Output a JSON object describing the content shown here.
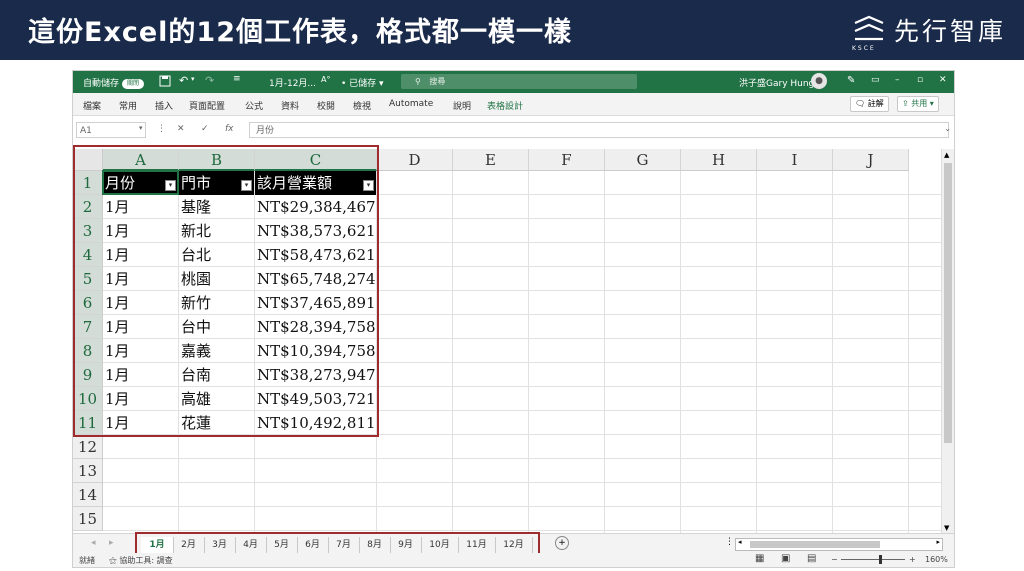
{
  "banner": {
    "title": "這份Excel的12個工作表，格式都一模一樣",
    "logo_text": "先行智庫",
    "logo_sub": "KSCE"
  },
  "excel": {
    "titlebar": {
      "autosave_label": "自動儲存",
      "autosave_state": "關閉",
      "doc_title": "1月-12月...",
      "save_status": "已儲存",
      "search_placeholder": "搜尋",
      "user_name": "洪子盛Gary Hung"
    },
    "ribbon": {
      "tabs": [
        "檔案",
        "常用",
        "插入",
        "頁面配置",
        "公式",
        "資料",
        "校閱",
        "檢視",
        "Automate",
        "說明",
        "表格設計"
      ],
      "comments_label": "註解",
      "share_label": "共用"
    },
    "formula_bar": {
      "name_box": "A1",
      "fx": "fx",
      "content": "月份"
    },
    "columns": [
      "A",
      "B",
      "C",
      "D",
      "E",
      "F",
      "G",
      "H",
      "I",
      "J"
    ],
    "rows": [
      "1",
      "2",
      "3",
      "4",
      "5",
      "6",
      "7",
      "8",
      "9",
      "10",
      "11",
      "12",
      "13",
      "14",
      "15"
    ],
    "table": {
      "headers": [
        "月份",
        "門市",
        "該月營業額"
      ],
      "rows": [
        [
          "1月",
          "基隆",
          "NT$29,384,467"
        ],
        [
          "1月",
          "新北",
          "NT$38,573,621"
        ],
        [
          "1月",
          "台北",
          "NT$58,473,621"
        ],
        [
          "1月",
          "桃園",
          "NT$65,748,274"
        ],
        [
          "1月",
          "新竹",
          "NT$37,465,891"
        ],
        [
          "1月",
          "台中",
          "NT$28,394,758"
        ],
        [
          "1月",
          "嘉義",
          "NT$10,394,758"
        ],
        [
          "1月",
          "台南",
          "NT$38,273,947"
        ],
        [
          "1月",
          "高雄",
          "NT$49,503,721"
        ],
        [
          "1月",
          "花蓮",
          "NT$10,492,811"
        ]
      ]
    },
    "sheets": [
      "1月",
      "2月",
      "3月",
      "4月",
      "5月",
      "6月",
      "7月",
      "8月",
      "9月",
      "10月",
      "11月",
      "12月"
    ],
    "active_sheet": "1月",
    "status": {
      "ready": "就緒",
      "accessibility": "協助工具: 調查",
      "zoom": "160%"
    },
    "accent_color": "#217346",
    "highlight_color": "#a02b2f"
  }
}
